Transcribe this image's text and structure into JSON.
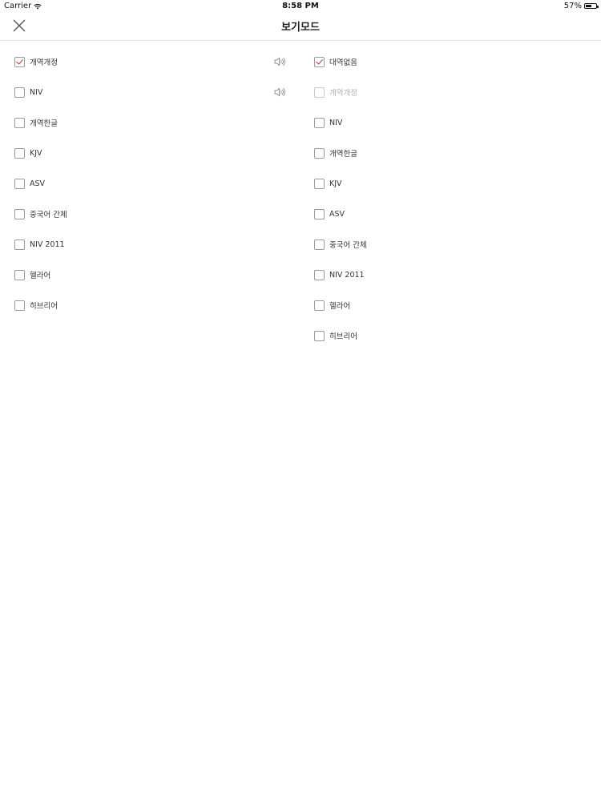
{
  "status_bar": {
    "carrier": "Carrier",
    "time": "8:58 PM",
    "battery": "57%",
    "battery_level": 0.57
  },
  "header": {
    "title": "보기모드",
    "close_icon": "close-icon"
  },
  "left_column": {
    "items": [
      {
        "label": "개역개정",
        "checked": true,
        "speaker": true
      },
      {
        "label": "NIV",
        "checked": false,
        "speaker": true
      },
      {
        "label": "개역한글",
        "checked": false,
        "speaker": false
      },
      {
        "label": "KJV",
        "checked": false,
        "speaker": false
      },
      {
        "label": "ASV",
        "checked": false,
        "speaker": false
      },
      {
        "label": "중국어 간체",
        "checked": false,
        "speaker": false
      },
      {
        "label": "NIV 2011",
        "checked": false,
        "speaker": false
      },
      {
        "label": "헬라어",
        "checked": false,
        "speaker": false
      },
      {
        "label": "히브리어",
        "checked": false,
        "speaker": false
      }
    ]
  },
  "right_column": {
    "items": [
      {
        "label": "대역없음",
        "checked": true,
        "disabled": false
      },
      {
        "label": "개역개정",
        "checked": false,
        "disabled": true
      },
      {
        "label": "NIV",
        "checked": false,
        "disabled": false
      },
      {
        "label": "개역한글",
        "checked": false,
        "disabled": false
      },
      {
        "label": "KJV",
        "checked": false,
        "disabled": false
      },
      {
        "label": "ASV",
        "checked": false,
        "disabled": false
      },
      {
        "label": "중국어 간체",
        "checked": false,
        "disabled": false
      },
      {
        "label": "NIV 2011",
        "checked": false,
        "disabled": false
      },
      {
        "label": "헬라어",
        "checked": false,
        "disabled": false
      },
      {
        "label": "히브리어",
        "checked": false,
        "disabled": false
      }
    ]
  },
  "colors": {
    "accent": "#c0322b",
    "divider": "#e2e2e2",
    "checkbox_border": "#9a9a9a",
    "disabled_text": "#b0b0b0"
  }
}
